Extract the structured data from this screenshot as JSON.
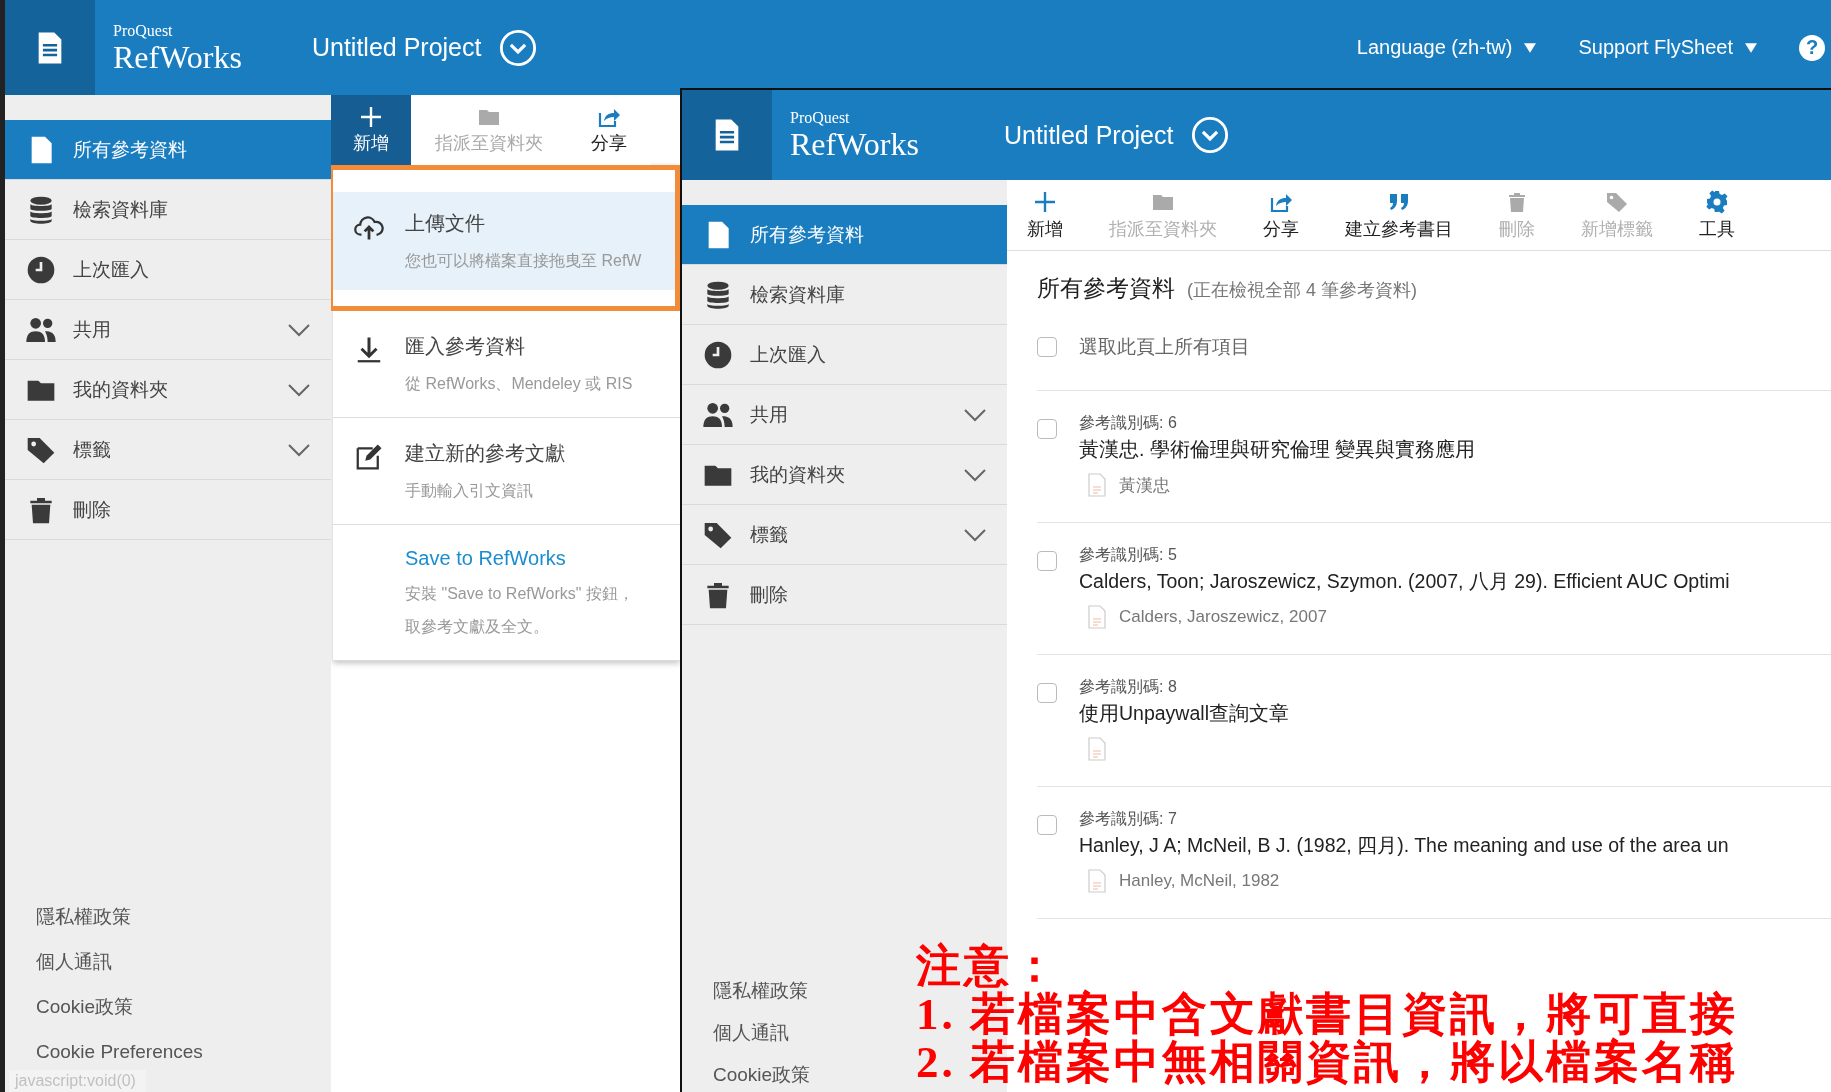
{
  "back_window": {
    "header": {
      "brand_small": "ProQuest",
      "brand": "RefWorks",
      "project": "Untitled Project",
      "links": [
        {
          "label": "Language (zh-tw)"
        },
        {
          "label": "Support FlySheet"
        }
      ],
      "help": "?"
    },
    "sidebar": [
      {
        "label": "所有參考資料",
        "kind": "plain",
        "selected": true
      },
      {
        "label": "檢索資料庫",
        "kind": "plain",
        "selected": false
      },
      {
        "label": "上次匯入",
        "kind": "plain",
        "selected": false
      },
      {
        "label": "共用",
        "kind": "group",
        "selected": false,
        "expanded": false
      },
      {
        "label": "我的資料夾",
        "kind": "group",
        "selected": false,
        "expanded": false
      },
      {
        "label": "標籤",
        "kind": "group",
        "selected": false,
        "expanded": false
      },
      {
        "label": "刪除",
        "kind": "plain",
        "selected": false
      }
    ],
    "footer_links": [
      "隱私權政策",
      "個人通訊",
      "Cookie政策",
      "Cookie Preferences"
    ],
    "status_text": "javascript:void(0)",
    "toolbar": [
      {
        "label": "新增",
        "selected": true,
        "disabled": false
      },
      {
        "label": "指派至資料夾",
        "selected": false,
        "disabled": true
      },
      {
        "label": "分享",
        "selected": false,
        "disabled": false
      }
    ],
    "add_menu": [
      {
        "kind": "action",
        "title": "上傳文件",
        "description": [
          "您也可以將檔案直接拖曳至 RefW"
        ],
        "highlighted": true
      },
      {
        "kind": "action",
        "title": "匯入參考資料",
        "description": [
          "從 RefWorks、Mendeley 或 RIS"
        ],
        "highlighted": false
      },
      {
        "kind": "action",
        "title": "建立新的參考文獻",
        "description": [
          "手動輸入引文資訊"
        ],
        "highlighted": false
      },
      {
        "kind": "link",
        "title": "Save to RefWorks",
        "description": [
          "安裝 \"Save to RefWorks\" 按鈕，",
          "取參考文獻及全文。"
        ],
        "highlighted": false
      }
    ]
  },
  "front_window": {
    "header": {
      "brand_small": "ProQuest",
      "brand": "RefWorks",
      "project": "Untitled Project"
    },
    "sidebar": [
      {
        "label": "所有參考資料",
        "kind": "plain",
        "selected": true
      },
      {
        "label": "檢索資料庫",
        "kind": "plain",
        "selected": false
      },
      {
        "label": "上次匯入",
        "kind": "plain",
        "selected": false
      },
      {
        "label": "共用",
        "kind": "group",
        "selected": false,
        "expanded": false
      },
      {
        "label": "我的資料夾",
        "kind": "group",
        "selected": false,
        "expanded": false
      },
      {
        "label": "標籤",
        "kind": "group",
        "selected": false,
        "expanded": false
      },
      {
        "label": "刪除",
        "kind": "plain",
        "selected": false
      }
    ],
    "footer_links": [
      "隱私權政策",
      "個人通訊",
      "Cookie政策"
    ],
    "toolbar": [
      {
        "label": "新增",
        "disabled": false
      },
      {
        "label": "指派至資料夾",
        "disabled": true
      },
      {
        "label": "分享",
        "disabled": false
      },
      {
        "label": "建立參考書目",
        "disabled": false
      },
      {
        "label": "刪除",
        "disabled": true
      },
      {
        "label": "新增標籤",
        "disabled": true
      },
      {
        "label": "工具",
        "disabled": false
      }
    ],
    "heading": "所有參考資料",
    "subheading": "(正在檢視全部 4 筆參考資料)",
    "select_all": {
      "label": "選取此頁上所有項目",
      "checked": false
    },
    "references": [
      {
        "id_label": "參考識別碼: 6",
        "title": "黃漢忠. 學術倫理與研究倫理 變異與實務應用",
        "authors": "黃漢忠",
        "checked": false
      },
      {
        "id_label": "參考識別碼: 5",
        "title": "Calders, Toon; Jaroszewicz, Szymon. (2007, 八月 29). Efficient AUC Optimi",
        "authors": "Calders, Jaroszewicz, 2007",
        "checked": false
      },
      {
        "id_label": "參考識別碼: 8",
        "title": "使用Unpaywall查詢文章",
        "checked": false
      },
      {
        "id_label": "參考識別碼: 7",
        "title": "Hanley, J A; McNeil, B J. (1982, 四月). The meaning and use of the area un",
        "authors": "Hanley, McNeil, 1982",
        "checked": false
      }
    ]
  },
  "annotation": {
    "title": "注意：",
    "lines": [
      "1.  若檔案中含文獻書目資訊，將可直接",
      "2.  若檔案中無相關資訊，將以檔案名稱"
    ]
  }
}
